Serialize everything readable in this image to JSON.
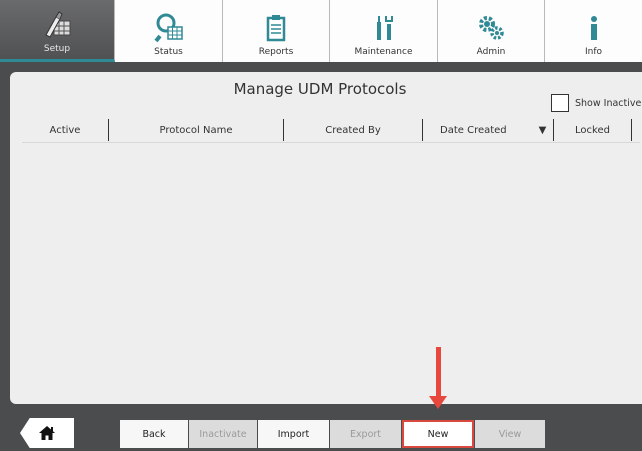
{
  "nav": {
    "tabs": [
      {
        "label": "Setup",
        "icon": "setup-icon",
        "active": true
      },
      {
        "label": "Status",
        "icon": "status-search-icon",
        "active": false
      },
      {
        "label": "Reports",
        "icon": "clipboard-icon",
        "active": false
      },
      {
        "label": "Maintenance",
        "icon": "tools-icon",
        "active": false
      },
      {
        "label": "Admin",
        "icon": "gears-icon",
        "active": false
      },
      {
        "label": "Info",
        "icon": "info-icon",
        "active": false
      }
    ]
  },
  "panel": {
    "title": "Manage UDM Protocols",
    "show_inactive_label": "Show Inactive",
    "show_inactive_checked": false,
    "columns": [
      "Active",
      "Protocol Name",
      "Created By",
      "Date Created",
      "Locked"
    ],
    "sort_indicator": "▼",
    "rows": []
  },
  "bottom": {
    "home_icon": "home-icon",
    "buttons": {
      "back": "Back",
      "inactivate": "Inactivate",
      "import": "Import",
      "export": "Export",
      "new": "New",
      "view": "View"
    }
  },
  "colors": {
    "accent": "#2f8a95",
    "annotation_red": "#e8473e",
    "background": "#4b4c4e"
  }
}
